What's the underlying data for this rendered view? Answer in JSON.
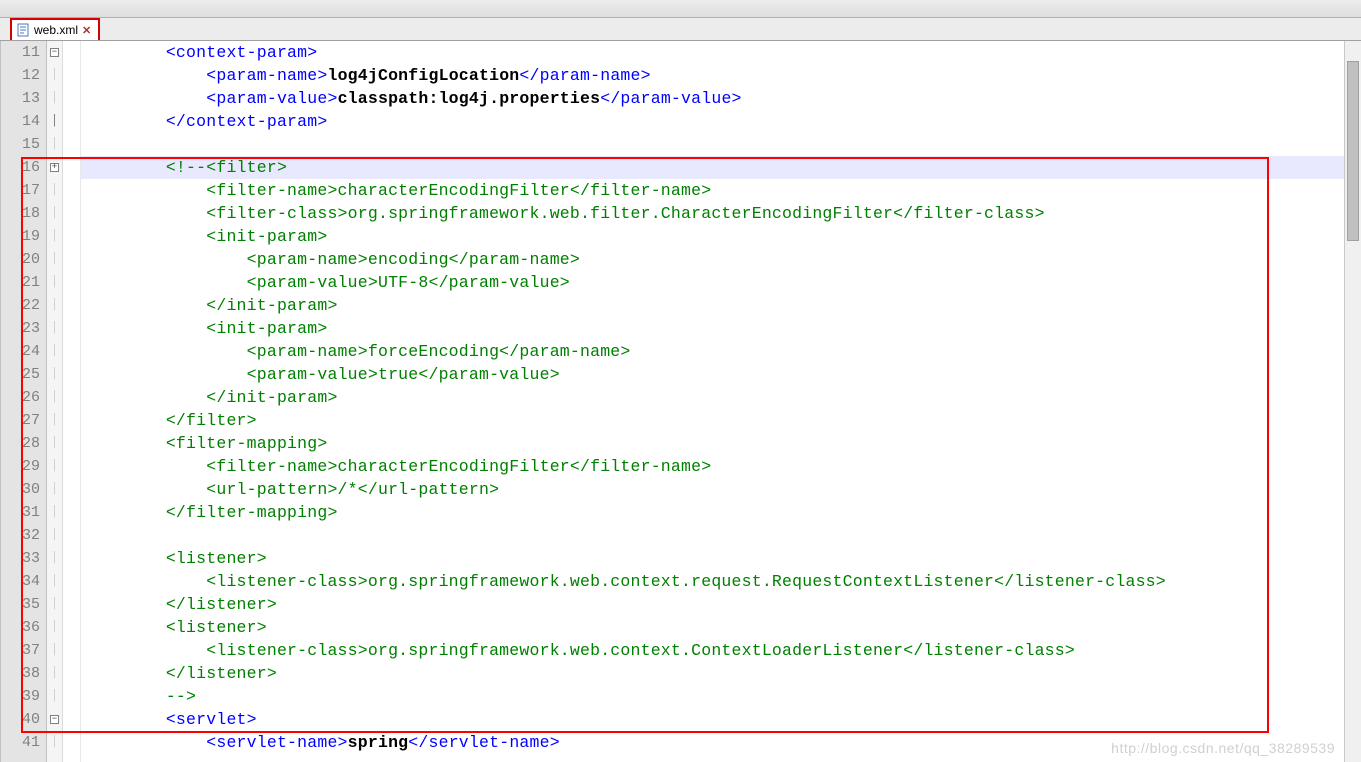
{
  "tab": {
    "filename": "web.xml"
  },
  "gutter": {
    "start": 11,
    "end": 41
  },
  "fold": {
    "11": "open",
    "14": "bar",
    "16": "close",
    "40": "open"
  },
  "current_line": 16,
  "code": [
    {
      "n": 11,
      "indent": 2,
      "spans": [
        {
          "c": "tag",
          "t": "<context-param>"
        }
      ]
    },
    {
      "n": 12,
      "indent": 3,
      "spans": [
        {
          "c": "tag",
          "t": "<param-name>"
        },
        {
          "c": "text-bold",
          "t": "log4jConfigLocation"
        },
        {
          "c": "tag",
          "t": "</param-name>"
        }
      ]
    },
    {
      "n": 13,
      "indent": 3,
      "spans": [
        {
          "c": "tag",
          "t": "<param-value>"
        },
        {
          "c": "text-bold",
          "t": "classpath:log4j.properties"
        },
        {
          "c": "tag",
          "t": "</param-value>"
        }
      ]
    },
    {
      "n": 14,
      "indent": 2,
      "spans": [
        {
          "c": "tag",
          "t": "</context-param>"
        }
      ]
    },
    {
      "n": 15,
      "indent": 0,
      "spans": []
    },
    {
      "n": 16,
      "indent": 2,
      "spans": [
        {
          "c": "comment",
          "t": "<!--<filter>"
        }
      ]
    },
    {
      "n": 17,
      "indent": 3,
      "spans": [
        {
          "c": "comment",
          "t": "<filter-name>characterEncodingFilter</filter-name>"
        }
      ]
    },
    {
      "n": 18,
      "indent": 3,
      "spans": [
        {
          "c": "comment",
          "t": "<filter-class>org.springframework.web.filter.CharacterEncodingFilter</filter-class>"
        }
      ]
    },
    {
      "n": 19,
      "indent": 3,
      "spans": [
        {
          "c": "comment",
          "t": "<init-param>"
        }
      ]
    },
    {
      "n": 20,
      "indent": 4,
      "spans": [
        {
          "c": "comment",
          "t": "<param-name>encoding</param-name>"
        }
      ]
    },
    {
      "n": 21,
      "indent": 4,
      "spans": [
        {
          "c": "comment",
          "t": "<param-value>UTF-8</param-value>"
        }
      ]
    },
    {
      "n": 22,
      "indent": 3,
      "spans": [
        {
          "c": "comment",
          "t": "</init-param>"
        }
      ]
    },
    {
      "n": 23,
      "indent": 3,
      "spans": [
        {
          "c": "comment",
          "t": "<init-param>"
        }
      ]
    },
    {
      "n": 24,
      "indent": 4,
      "spans": [
        {
          "c": "comment",
          "t": "<param-name>forceEncoding</param-name>"
        }
      ]
    },
    {
      "n": 25,
      "indent": 4,
      "spans": [
        {
          "c": "comment",
          "t": "<param-value>true</param-value>"
        }
      ]
    },
    {
      "n": 26,
      "indent": 3,
      "spans": [
        {
          "c": "comment",
          "t": "</init-param>"
        }
      ]
    },
    {
      "n": 27,
      "indent": 2,
      "spans": [
        {
          "c": "comment",
          "t": "</filter>"
        }
      ]
    },
    {
      "n": 28,
      "indent": 2,
      "spans": [
        {
          "c": "comment",
          "t": "<filter-mapping>"
        }
      ]
    },
    {
      "n": 29,
      "indent": 3,
      "spans": [
        {
          "c": "comment",
          "t": "<filter-name>characterEncodingFilter</filter-name>"
        }
      ]
    },
    {
      "n": 30,
      "indent": 3,
      "spans": [
        {
          "c": "comment",
          "t": "<url-pattern>/*</url-pattern>"
        }
      ]
    },
    {
      "n": 31,
      "indent": 2,
      "spans": [
        {
          "c": "comment",
          "t": "</filter-mapping>"
        }
      ]
    },
    {
      "n": 32,
      "indent": 0,
      "spans": []
    },
    {
      "n": 33,
      "indent": 2,
      "spans": [
        {
          "c": "comment",
          "t": "<listener>"
        }
      ]
    },
    {
      "n": 34,
      "indent": 3,
      "spans": [
        {
          "c": "comment",
          "t": "<listener-class>org.springframework.web.context.request.RequestContextListener</listener-class>"
        }
      ]
    },
    {
      "n": 35,
      "indent": 2,
      "spans": [
        {
          "c": "comment",
          "t": "</listener>"
        }
      ]
    },
    {
      "n": 36,
      "indent": 2,
      "spans": [
        {
          "c": "comment",
          "t": "<listener>"
        }
      ]
    },
    {
      "n": 37,
      "indent": 3,
      "spans": [
        {
          "c": "comment",
          "t": "<listener-class>org.springframework.web.context.ContextLoaderListener</listener-class>"
        }
      ]
    },
    {
      "n": 38,
      "indent": 2,
      "spans": [
        {
          "c": "comment",
          "t": "</listener>"
        }
      ]
    },
    {
      "n": 39,
      "indent": 2,
      "spans": [
        {
          "c": "comment",
          "t": "-->"
        }
      ]
    },
    {
      "n": 40,
      "indent": 2,
      "spans": [
        {
          "c": "tag",
          "t": "<servlet>"
        }
      ]
    },
    {
      "n": 41,
      "indent": 3,
      "spans": [
        {
          "c": "tag",
          "t": "<servlet-name>"
        },
        {
          "c": "text-bold",
          "t": "spring"
        },
        {
          "c": "tag",
          "t": "</servlet-name>"
        }
      ]
    }
  ],
  "watermark": "http://blog.csdn.net/qq_38289539"
}
